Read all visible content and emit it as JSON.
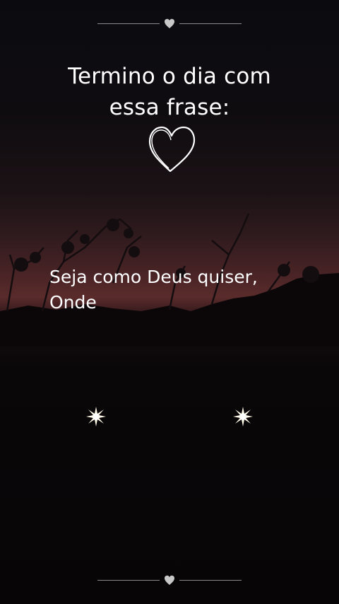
{
  "title_lines": [
    "Termino o dia com",
    "essa frase:"
  ],
  "quote_lines": [
    "Seja como Deus quiser,",
    "Onde"
  ],
  "icons": {
    "top_divider": "heart-icon",
    "title_heart": "heart-outline-icon",
    "stars": "sparkle-icon",
    "bottom_divider": "heart-icon"
  },
  "colors": {
    "text": "#ffffff",
    "sky_glow": "#5a2b2b",
    "background": "#0a0709"
  }
}
